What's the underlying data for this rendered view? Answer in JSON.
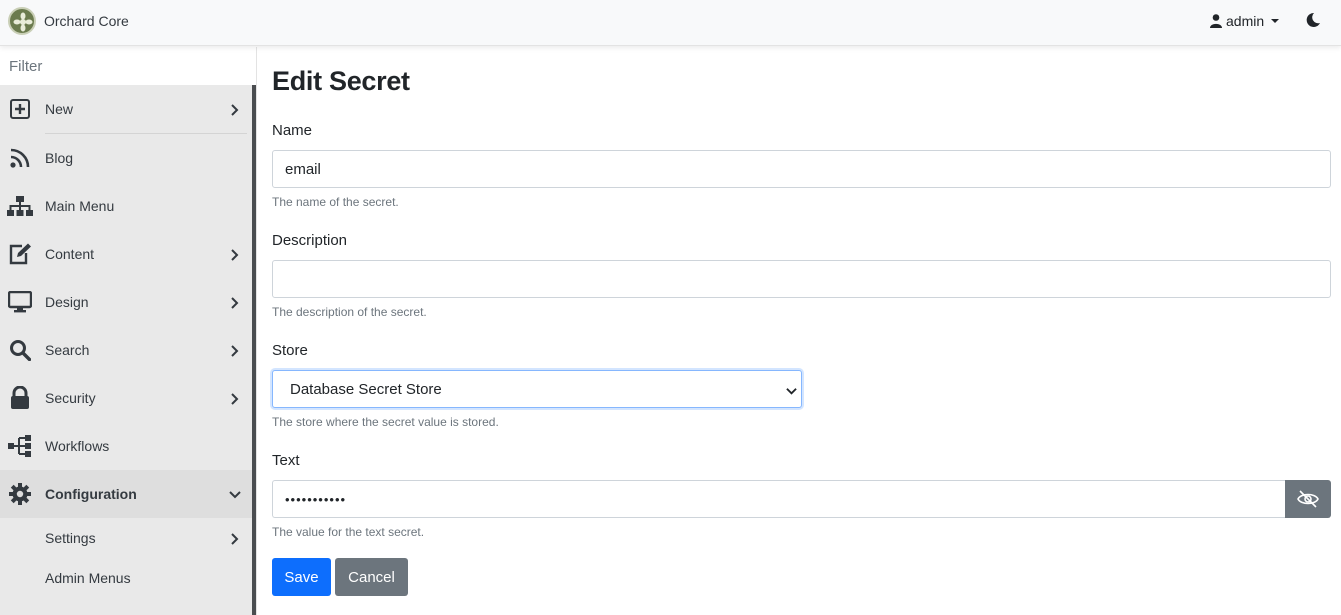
{
  "navbar": {
    "brand": "Orchard Core",
    "user": "admin",
    "icons": [
      "orchard-logo",
      "user-icon",
      "caret-down-icon",
      "moon-icon"
    ]
  },
  "sidebar": {
    "filter_placeholder": "Filter",
    "items": [
      {
        "label": "New",
        "icon": "plus-square-icon",
        "has_children": true
      },
      {
        "label": "Blog",
        "icon": "rss-icon",
        "has_children": false
      },
      {
        "label": "Main Menu",
        "icon": "sitemap-icon",
        "has_children": false
      },
      {
        "label": "Content",
        "icon": "edit-icon",
        "has_children": true
      },
      {
        "label": "Design",
        "icon": "desktop-icon",
        "has_children": true
      },
      {
        "label": "Search",
        "icon": "search-icon",
        "has_children": true
      },
      {
        "label": "Security",
        "icon": "lock-icon",
        "has_children": true
      },
      {
        "label": "Workflows",
        "icon": "workflow-icon",
        "has_children": false
      },
      {
        "label": "Configuration",
        "icon": "gear-icon",
        "expanded": true
      }
    ],
    "subitems": [
      {
        "label": "Settings",
        "has_children": true
      },
      {
        "label": "Admin Menus",
        "has_children": false
      }
    ]
  },
  "page": {
    "title": "Edit Secret",
    "name": {
      "label": "Name",
      "value": "email",
      "help": "The name of the secret."
    },
    "description": {
      "label": "Description",
      "value": "",
      "help": "The description of the secret."
    },
    "store": {
      "label": "Store",
      "selected": "Database Secret Store",
      "help": "The store where the secret value is stored."
    },
    "text": {
      "label": "Text",
      "masked_value": "•••••••••••",
      "help": "The value for the text secret."
    },
    "save_label": "Save",
    "cancel_label": "Cancel"
  },
  "colors": {
    "primary": "#0d6efd",
    "secondary": "#6c757d",
    "sidebar_bg": "#e9e9e9",
    "navbar_bg": "#f8f9fa"
  }
}
